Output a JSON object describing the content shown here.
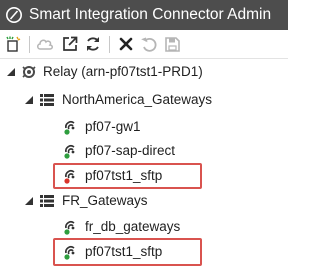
{
  "window": {
    "title": "Smart Integration Connector Admin",
    "icon": "circle-slash-logo-icon"
  },
  "toolbar": {
    "buttons": [
      {
        "name": "new-item-button",
        "icon": "new-sparkle-icon",
        "enabled": true
      },
      {
        "name": "cloud-button",
        "icon": "cloud-icon",
        "enabled": false
      },
      {
        "name": "open-external-button",
        "icon": "open-external-icon",
        "enabled": true
      },
      {
        "name": "refresh-button",
        "icon": "refresh-icon",
        "enabled": true
      },
      {
        "name": "delete-button",
        "icon": "close-x-icon",
        "enabled": true
      },
      {
        "name": "undo-button",
        "icon": "undo-icon",
        "enabled": false
      },
      {
        "name": "save-button",
        "icon": "save-icon",
        "enabled": false
      }
    ]
  },
  "tree": {
    "root": {
      "label": "Relay (arn-pf07tst1-PRD1)",
      "expanded": true,
      "icon": "relay-icon"
    },
    "groups": [
      {
        "label": "NorthAmerica_Gateways",
        "expanded": true,
        "icon": "server-list-icon",
        "items": [
          {
            "label": "pf07-gw1",
            "status": "online",
            "highlighted": false
          },
          {
            "label": "pf07-sap-direct",
            "status": "online",
            "highlighted": false
          },
          {
            "label": "pf07tst1_sftp",
            "status": "offline",
            "highlighted": true
          }
        ]
      },
      {
        "label": "FR_Gateways",
        "expanded": true,
        "icon": "server-list-icon",
        "items": [
          {
            "label": "fr_db_gateways",
            "status": "online",
            "highlighted": false
          },
          {
            "label": "pf07tst1_sftp",
            "status": "online",
            "highlighted": true
          }
        ]
      }
    ]
  },
  "colors": {
    "titlebar": "#4d4d4d",
    "online": "#2e9e3e",
    "offline": "#d9342b",
    "highlight": "#d9534f",
    "icon_dark": "#333333",
    "icon_disabled": "#b5b5b5"
  }
}
